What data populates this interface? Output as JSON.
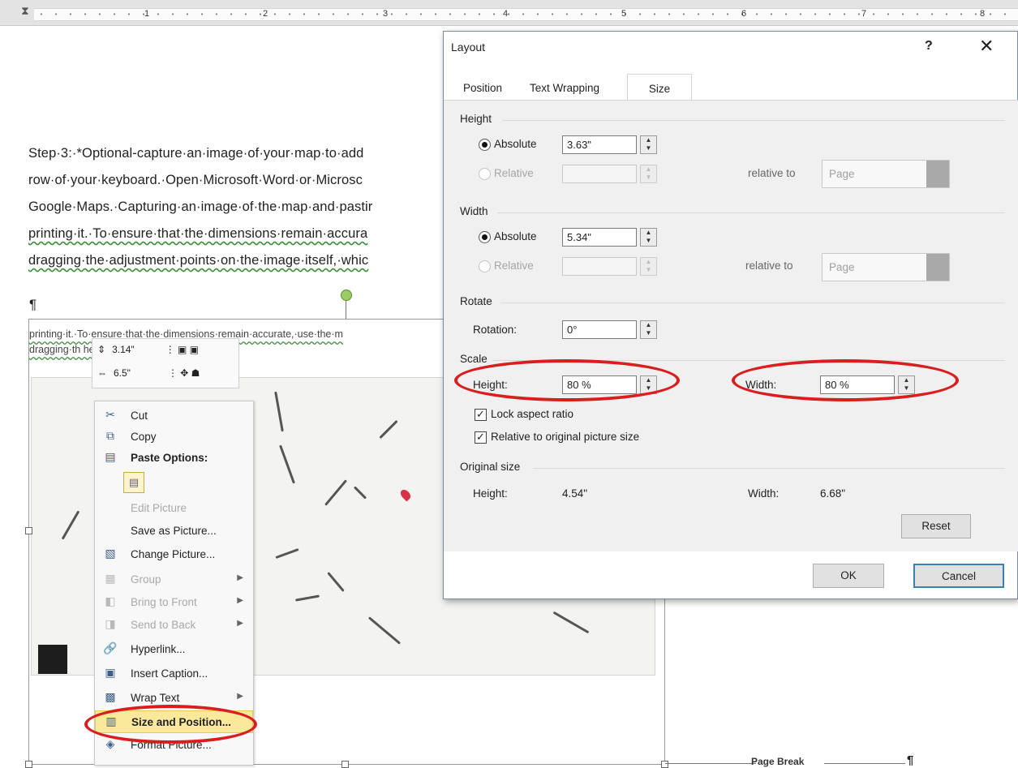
{
  "ruler": {
    "numbers": [
      "1",
      "2",
      "3",
      "4",
      "5",
      "6",
      "7",
      "8"
    ]
  },
  "document": {
    "lines": [
      "Step·3:·*Optional-capture·an·image·of·your·map·to·add",
      "row·of·your·keyboard.·Open·Microsoft·Word·or·Microsc",
      "Google·Maps.·Capturing·an·image·of·the·map·and·pastir",
      "printing·it.·To·ensure·that·the·dimensions·remain·accura",
      "dragging·the·adjustment·points·on·the·image·itself,·whic"
    ],
    "pilcrow": "¶",
    "picture_text_1": "printing·it.·To·ensure·that·the·dimensions·remain·accurate,·use·the·m",
    "picture_text_2": "dragging·th                              he·image·itself,·which·can·distort",
    "page_break": "Page Break",
    "page_break_pilcrow": "¶"
  },
  "mini_toolbar": {
    "height_value": "3.14\"",
    "width_value": "6.5\""
  },
  "context_menu": {
    "items": [
      {
        "label": "Cut",
        "icon": "scissors-icon"
      },
      {
        "label": "Copy",
        "icon": "copy-icon"
      },
      {
        "label": "Paste Options:",
        "icon": "paste-icon"
      },
      {
        "label": "Edit Picture",
        "icon": ""
      },
      {
        "label": "Save as Picture...",
        "icon": ""
      },
      {
        "label": "Change Picture...",
        "icon": "change-picture-icon"
      },
      {
        "label": "Group",
        "icon": "group-icon"
      },
      {
        "label": "Bring to Front",
        "icon": "bring-front-icon"
      },
      {
        "label": "Send to Back",
        "icon": "send-back-icon"
      },
      {
        "label": "Hyperlink...",
        "icon": "hyperlink-icon"
      },
      {
        "label": "Insert Caption...",
        "icon": "caption-icon"
      },
      {
        "label": "Wrap Text",
        "icon": "wrap-text-icon"
      },
      {
        "label": "Size and Position...",
        "icon": "size-position-icon"
      },
      {
        "label": "Format Picture...",
        "icon": "format-picture-icon"
      }
    ]
  },
  "dialog": {
    "title": "Layout",
    "help": "?",
    "close": "✕",
    "tabs": [
      "Position",
      "Text Wrapping",
      "Size"
    ],
    "active_tab": "Size",
    "height": {
      "group": "Height",
      "absolute_label": "Absolute",
      "absolute_value": "3.63\"",
      "relative_label": "Relative",
      "relative_to_label": "relative to",
      "relative_to_value": "Page"
    },
    "width": {
      "group": "Width",
      "absolute_label": "Absolute",
      "absolute_value": "5.34\"",
      "relative_label": "Relative",
      "relative_to_label": "relative to",
      "relative_to_value": "Page"
    },
    "rotate": {
      "group": "Rotate",
      "label": "Rotation:",
      "value": "0°"
    },
    "scale": {
      "group": "Scale",
      "height_label": "Height:",
      "height_value": "80 %",
      "width_label": "Width:",
      "width_value": "80 %",
      "lock_aspect": "Lock aspect ratio",
      "relative_original": "Relative to original picture size"
    },
    "original": {
      "group": "Original size",
      "height_label": "Height:",
      "height_value": "4.54\"",
      "width_label": "Width:",
      "width_value": "6.68\""
    },
    "reset": "Reset",
    "ok": "OK",
    "cancel": "Cancel"
  },
  "colors": {
    "highlight_ellipse": "#d81e1e",
    "menu_highlight": "#fbe99b",
    "primary_button_border": "#3c7fb1"
  }
}
